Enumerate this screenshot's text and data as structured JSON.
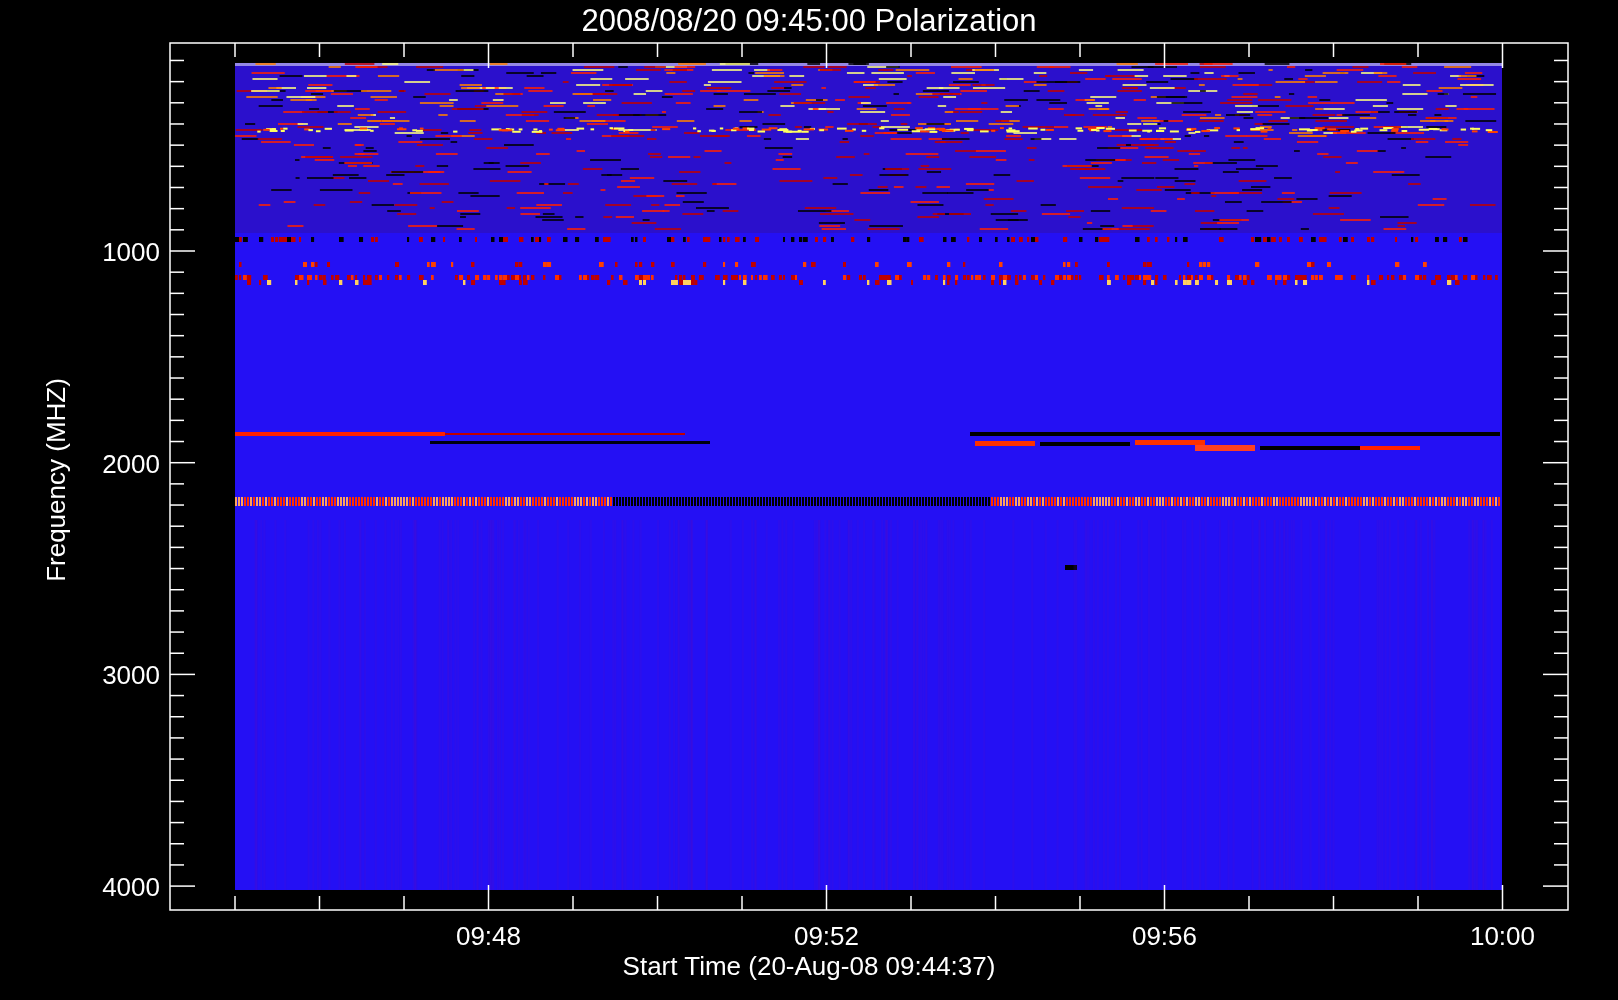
{
  "title": "2008/08/20 09:45:00 Polarization",
  "plot": {
    "ylabel": "Frequency (MHZ)",
    "xlabel": "Start Time (20-Aug-08 09:44:37)",
    "y_tick_labels": [
      "1000",
      "2000",
      "3000",
      "4000"
    ],
    "x_tick_labels": [
      "09:48",
      "09:52",
      "09:56",
      "10:00"
    ]
  }
}
